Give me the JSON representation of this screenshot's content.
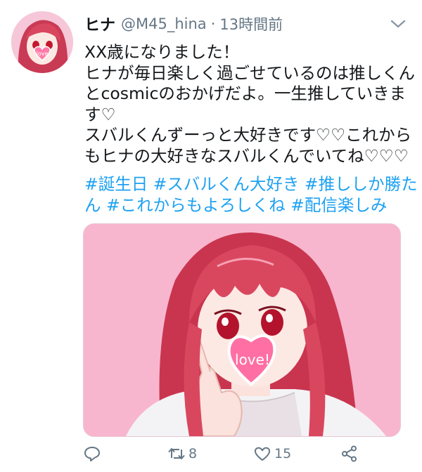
{
  "tweet": {
    "display_name": "ヒナ",
    "handle": "@M45_hina",
    "separator": "·",
    "time": "13時間前",
    "lines": [
      "XX歳になりました！",
      "ヒナが毎日楽しく過ごせているのは推しくん",
      "とcosmicのおかげだよ。一生推していきま",
      "す♡",
      "スバルくんずーっと大好きです♡♡これから",
      "もヒナの大好きなスバルくんでいてね♡♡♡"
    ],
    "hashtags": [
      "#誕生日",
      "#スバルくん大好き",
      "#推ししか勝た",
      "ん",
      "#これからもよろしくね",
      "#配信楽しみ"
    ],
    "media_caption": "love!",
    "avatar_caption": "love"
  },
  "actions": {
    "reply_icon": "reply-icon",
    "retweet_icon": "retweet-icon",
    "retweet_count": "8",
    "like_icon": "heart-icon",
    "like_count": "15",
    "share_icon": "share-icon"
  },
  "colors": {
    "link": "#1da1f2",
    "muted": "#657786",
    "text": "#14171a",
    "media_bg": "#f8b6ce",
    "hair": "#d9475e"
  }
}
